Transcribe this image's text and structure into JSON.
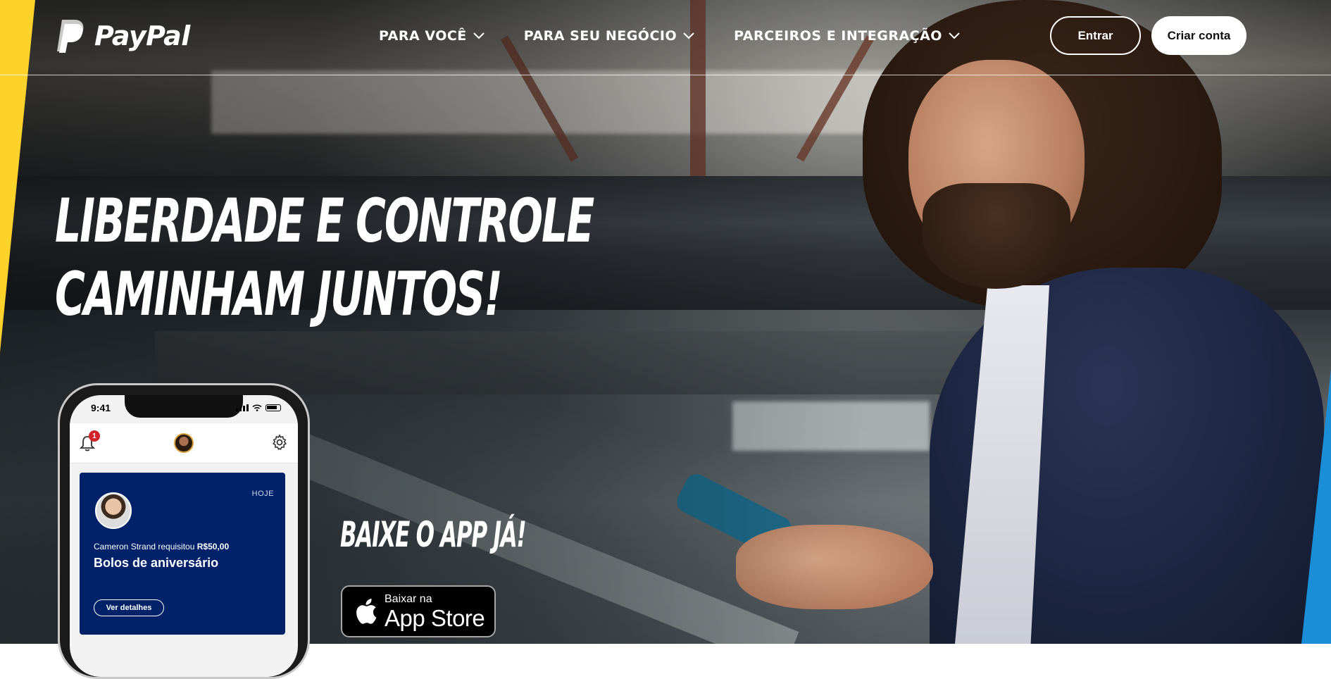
{
  "brand": {
    "logo_text": "PayPal",
    "logo_icon": "paypal-logo-icon"
  },
  "nav": {
    "items": [
      {
        "label": "PARA VOCÊ",
        "icon": "chevron-down-icon"
      },
      {
        "label": "PARA SEU NEGÓCIO",
        "icon": "chevron-down-icon"
      },
      {
        "label": "PARCEIROS E INTEGRAÇÃO",
        "icon": "chevron-down-icon"
      }
    ],
    "login_label": "Entrar",
    "signup_label": "Criar conta"
  },
  "hero": {
    "headline_line1": "LIBERDADE E CONTROLE",
    "headline_line2": "CAMINHAM JUNTOS!",
    "download_label": "BAIXE O APP JÁ!",
    "appstore": {
      "small_text": "Baixar na",
      "big_text": "App Store",
      "icon": "apple-icon"
    }
  },
  "phone_mockup": {
    "status_time": "9:41",
    "notification_count": "1",
    "card": {
      "date": "HOJE",
      "request_text": "Cameron Strand requisitou",
      "amount": "R$50,00",
      "title": "Bolos de aniversário",
      "button_label": "Ver detalhes"
    }
  },
  "colors": {
    "paypal_navy": "#012169",
    "accent_yellow": "#fdd22b",
    "accent_blue": "#1a8fd8",
    "badge_red": "#d2232a"
  }
}
